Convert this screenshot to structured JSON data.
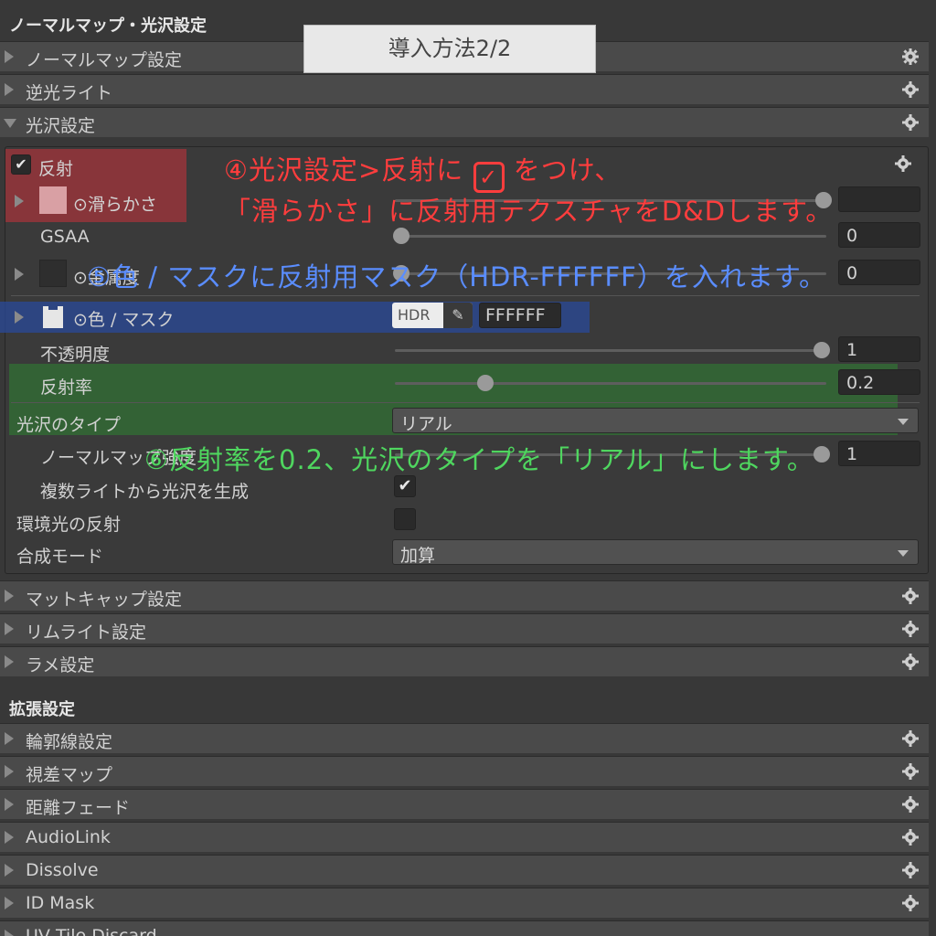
{
  "title_banner": "導入方法2/2",
  "sections": {
    "top_header": "ノーマルマップ・光沢設定",
    "ext_header": "拡張設定"
  },
  "foldouts_top": [
    {
      "label": "ノーマルマップ設定",
      "open": false
    },
    {
      "label": "逆光ライト",
      "open": false
    },
    {
      "label": "光沢設定",
      "open": true
    }
  ],
  "reflection_panel": {
    "reflection_label": "反射",
    "reflection_checked": true,
    "smoothness_label": "⊙滑らかさ",
    "smoothness_value": "",
    "gsaa_label": "GSAA",
    "gsaa_value": "0",
    "row3_label": "⊙金属度",
    "row3_value": "0",
    "color_mask_label": "⊙色 / マスク",
    "hdr_label": "HDR",
    "color_hex": "FFFFFF",
    "opacity_label": "不透明度",
    "opacity_value": "1",
    "reflectance_label": "反射率",
    "reflectance_value": "0.2",
    "gloss_type_label": "光沢のタイプ",
    "gloss_type_value": "リアル",
    "normal_strength_label": "ノーマルマップ強度",
    "normal_strength_value": "1",
    "multi_light_label": "複数ライトから光沢を生成",
    "multi_light_checked": true,
    "env_reflection_label": "環境光の反射",
    "env_reflection_checked": false,
    "blend_mode_label": "合成モード",
    "blend_mode_value": "加算"
  },
  "foldouts_mid": [
    {
      "label": "マットキャップ設定"
    },
    {
      "label": "リムライト設定"
    },
    {
      "label": "ラメ設定"
    }
  ],
  "foldouts_ext": [
    {
      "label": "輪郭線設定"
    },
    {
      "label": "視差マップ"
    },
    {
      "label": "距離フェード"
    },
    {
      "label": "AudioLink"
    },
    {
      "label": "Dissolve"
    },
    {
      "label": "ID Mask"
    },
    {
      "label": "UV Tile Discard"
    }
  ],
  "annotations": {
    "step4_line1_a": "④光沢設定>反射に",
    "step4_line1_b": "をつけ、",
    "step4_line2": "「滑らかさ」に反射用テクスチャをD&Dします。",
    "step5": "⑤色 / マスクに反射用マスク（HDR-FFFFFF）を入れます。",
    "step6": "⑥反射率を0.2、光沢のタイプを「リアル」にします。"
  },
  "colors": {
    "red_highlight": "#c8323a",
    "blue_highlight": "#2a4a9a",
    "green_highlight": "#2e7d32",
    "red_text": "#ff3d3d",
    "blue_text": "#5a8dff",
    "green_text": "#4fd65f"
  },
  "icons": {
    "gear": "gear-icon",
    "checkmark": "check-icon",
    "eyedropper": "eyedropper-icon",
    "dropdown": "chevron-down-icon"
  }
}
